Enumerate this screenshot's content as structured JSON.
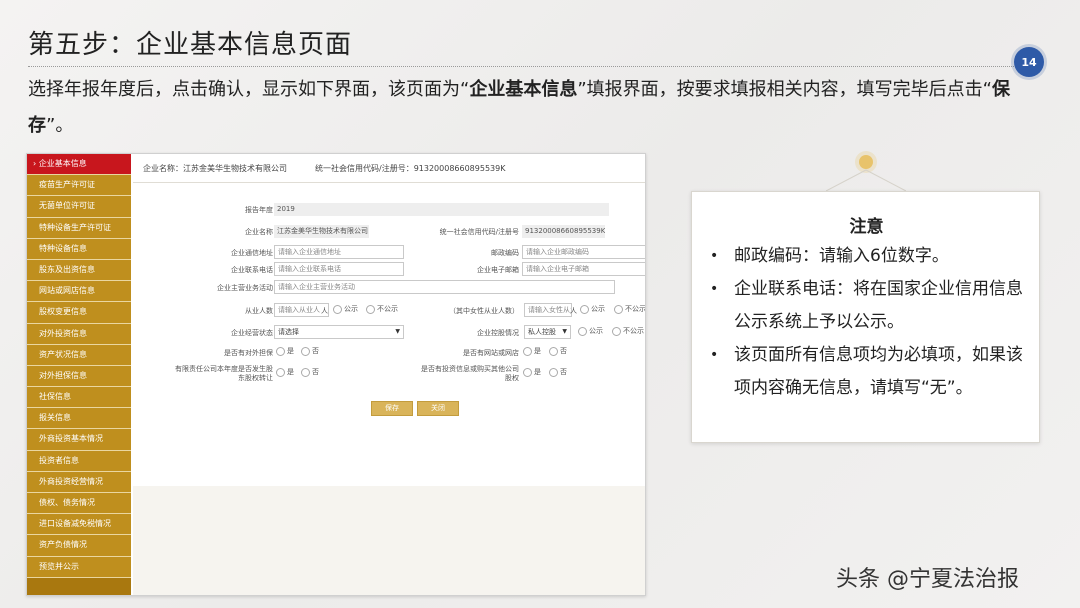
{
  "slide": {
    "title": "第五步：企业基本信息页面",
    "page_number": "14",
    "intro_part1": "选择年报年度后，点击确认，显示如下界面，该页面为“",
    "intro_bold1": "企业基本信息",
    "intro_part2": "”填报界面，按要求填报相关内容，填写完毕后点击“",
    "intro_bold2": "保存",
    "intro_part3": "”。"
  },
  "sidebar": {
    "items": [
      "企业基本信息",
      "疫苗生产许可证",
      "无菌单位许可证",
      "特种设备生产许可证",
      "特种设备信息",
      "股东及出资信息",
      "网站或网店信息",
      "股权变更信息",
      "对外投资信息",
      "资产状况信息",
      "对外担保信息",
      "社保信息",
      "报关信息",
      "外商投资基本情况",
      "投资者信息",
      "外商投资经营情况",
      "债权、债务情况",
      "进口设备减免税情况",
      "资产负债情况",
      "预览并公示"
    ]
  },
  "form": {
    "company_name_label": "企业名称：江苏金美华生物技术有限公司",
    "credit_code_label": "统一社会信用代码/注册号：91320008660895539K",
    "report_year_label": "报告年度",
    "report_year_value": "2019",
    "name_label": "企业名称",
    "name_value": "江苏金美华生物技术有限公司",
    "code_label": "统一社会信用代码/注册号",
    "code_value": "91320008660895539K",
    "address_label": "企业通信地址",
    "address_placeholder": "请输入企业通信地址",
    "postcode_label": "邮政编码",
    "postcode_placeholder": "请输入企业邮政编码",
    "phone_label": "企业联系电话",
    "phone_placeholder": "请输入企业联系电话",
    "email_label": "企业电子邮箱",
    "email_placeholder": "请输入企业电子邮箱",
    "business_label": "企业主营业务活动",
    "business_placeholder": "请输入企业主营业务活动",
    "employees_label": "从业人数",
    "employees_placeholder": "请输入从业人",
    "employees_unit": "人",
    "female_label": "（其中女性从业人数）",
    "female_placeholder": "请输入女性从业",
    "female_unit": "人",
    "public": "公示",
    "not_public": "不公示",
    "status_label": "企业经营状态",
    "status_value": "请选择",
    "holding_label": "企业控股情况",
    "holding_value": "私人控股",
    "guarantee_label": "是否有对外担保",
    "website_label": "是否有网站或网店",
    "equity_label": "有限责任公司本年度是否发生股东股权转让",
    "invest_label": "是否有投资信息或购买其他公司股权",
    "yes": "是",
    "no": "否",
    "save_button": "保存",
    "close_button": "关闭"
  },
  "note": {
    "title": "注意",
    "items": [
      "邮政编码：请输入6位数字。",
      "企业联系电话：将在国家企业信用信息公示系统上予以公示。",
      "该页面所有信息项均为必填项，如果该项内容确无信息，请填写“无”。"
    ]
  },
  "watermark": "头条 @宁夏法治报",
  "colors": {
    "sidebar": "#bf8f1e",
    "sidebar_active": "#c8161d",
    "badge": "#2e5aa7",
    "button": "#d9b45a"
  }
}
